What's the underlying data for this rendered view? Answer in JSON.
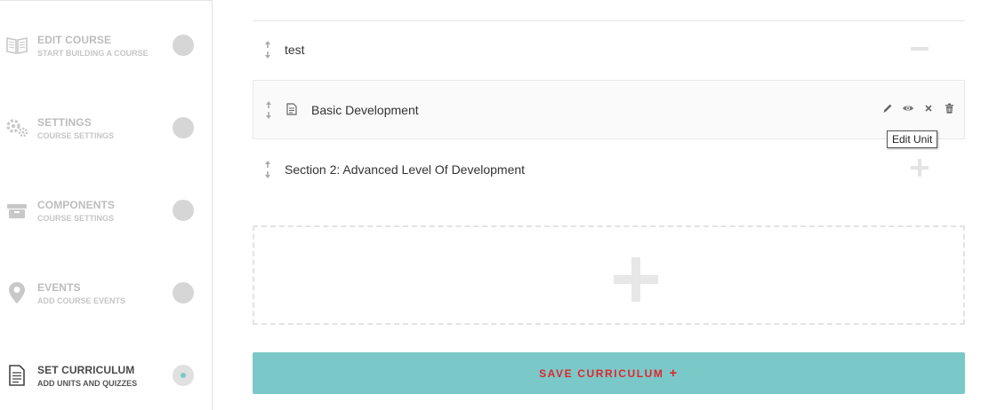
{
  "sidebar": {
    "steps": [
      {
        "title": "EDIT COURSE",
        "subtitle": "START BUILDING A COURSE",
        "icon": "book-icon"
      },
      {
        "title": "SETTINGS",
        "subtitle": "COURSE SETTINGS",
        "icon": "gears-icon"
      },
      {
        "title": "COMPONENTS",
        "subtitle": "COURSE SETTINGS",
        "icon": "archive-icon"
      },
      {
        "title": "EVENTS",
        "subtitle": "ADD COURSE EVENTS",
        "icon": "map-pin-icon"
      },
      {
        "title": "SET CURRICULUM",
        "subtitle": "ADD UNITS AND QUIZZES",
        "icon": "document-icon",
        "active": true
      }
    ]
  },
  "curriculum": {
    "section1": {
      "title": "test",
      "action_icon": "minus-icon"
    },
    "unit1": {
      "title": "Basic Development",
      "icon": "document-icon",
      "actions": [
        "edit-icon",
        "eye-icon",
        "close-icon",
        "trash-icon"
      ]
    },
    "tooltip": "Edit Unit",
    "section2": {
      "title": "Section 2: Advanced Level Of Development",
      "action_icon": "plus-icon"
    },
    "dropzone_icon": "plus-icon",
    "save_label": "SAVE CURRICULUM",
    "save_icon": "+"
  },
  "colors": {
    "accent": "#7bc8c8",
    "save_text": "#e0262b",
    "muted": "#bdbdbd"
  }
}
